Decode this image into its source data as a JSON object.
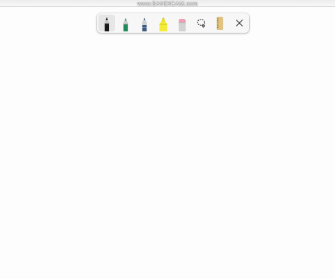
{
  "watermark": "www.BANDICAM.com",
  "toolbar": {
    "tools": [
      {
        "name": "ballpoint-pen",
        "icon": "black-pen-icon",
        "color": "#1a1a1a",
        "selected": true
      },
      {
        "name": "pen-green",
        "icon": "green-pen-icon",
        "color": "#1f8a5b",
        "selected": false
      },
      {
        "name": "pencil",
        "icon": "blue-pencil-icon",
        "color": "#3d5a80",
        "selected": false
      },
      {
        "name": "highlighter",
        "icon": "yellow-highlighter-icon",
        "color": "#f4ea3a",
        "selected": false
      },
      {
        "name": "eraser",
        "icon": "eraser-icon",
        "color": "#f0a0b4",
        "selected": false
      },
      {
        "name": "lasso-select",
        "icon": "lasso-icon",
        "color": "#333333",
        "selected": false
      },
      {
        "name": "ruler",
        "icon": "ruler-icon",
        "color": "#e3c27a",
        "selected": false
      },
      {
        "name": "close",
        "icon": "close-icon",
        "color": "#333333",
        "selected": false
      }
    ]
  }
}
